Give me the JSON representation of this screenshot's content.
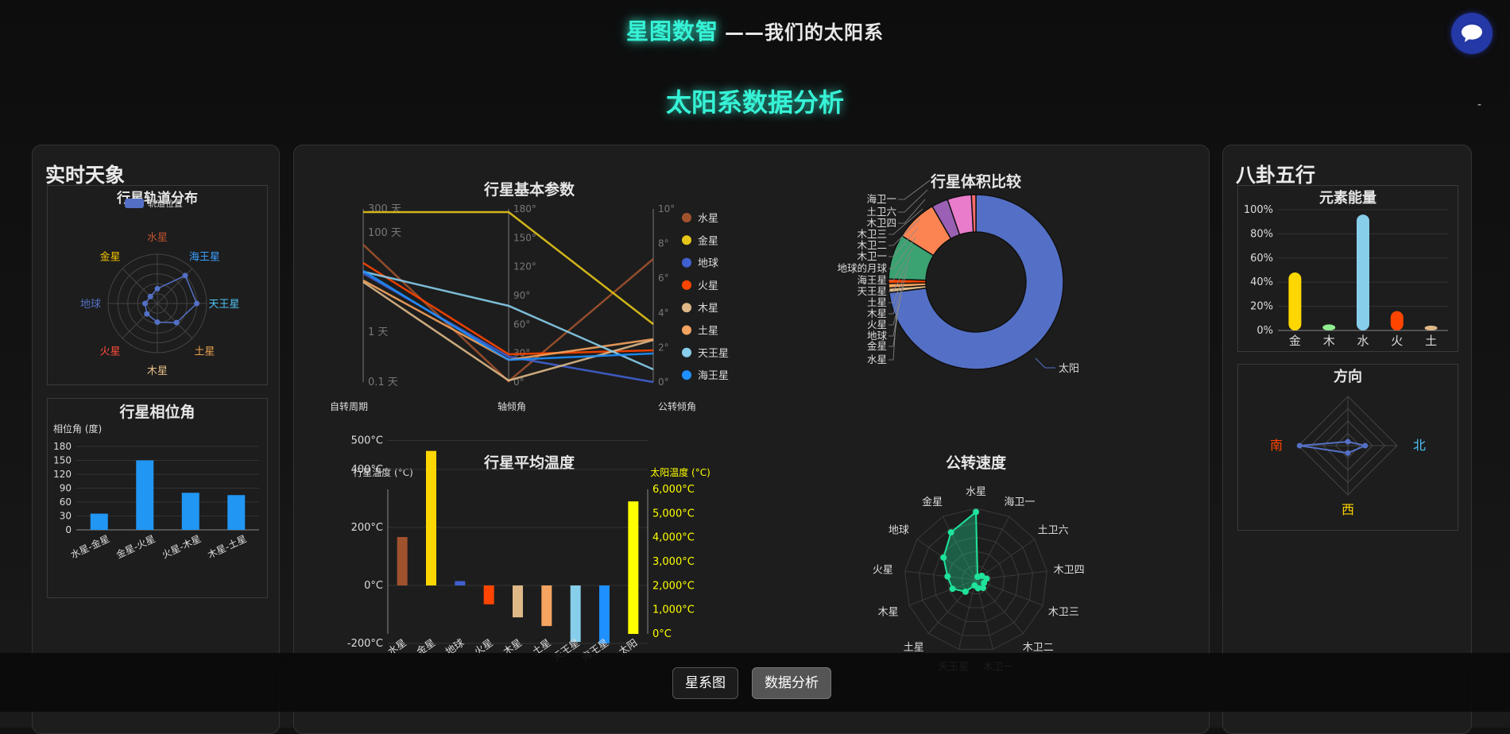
{
  "header": {
    "brand": "星图数智",
    "subtitle": "——我们的太阳系"
  },
  "page": {
    "title": "太阳系数据分析",
    "dash": "-"
  },
  "chat_icon": "chat-bubble-icon",
  "left_panel": {
    "title": "实时天象",
    "orbit": {
      "title": "行星轨道分布",
      "legend": "轨道位置",
      "labels": [
        "水星",
        "海王星",
        "天王星",
        "土星",
        "木星",
        "火星",
        "地球",
        "金星"
      ],
      "colors": [
        "#c0532f",
        "#3aa0ff",
        "#4fc3f7",
        "#e8a04c",
        "#e8c08a",
        "#ff4d3a",
        "#5470c6",
        "#f5c400"
      ],
      "values": [
        0.3,
        0.8,
        0.8,
        0.55,
        0.38,
        0.3,
        0.25,
        0.2
      ]
    },
    "aspect": {
      "title": "行星相位角",
      "ylabel": "相位角 (度)",
      "yticks": [
        "180",
        "150",
        "120",
        "90",
        "60",
        "30",
        "0"
      ],
      "categories": [
        "水星-金星",
        "金星-火星",
        "火星-木星",
        "木星-土星"
      ],
      "values": [
        35,
        150,
        80,
        75
      ]
    }
  },
  "center_panel": {
    "params_chart": {
      "title": "行星基本参数",
      "axes": [
        "自转周期",
        "轴倾角",
        "公转倾角"
      ],
      "ticks1": [
        "300 天",
        "100 天",
        "1 天",
        "0.1 天"
      ],
      "ticks2": [
        "180°",
        "150°",
        "120°",
        "90°",
        "60°",
        "30°",
        "0°"
      ],
      "ticks3": [
        "10°",
        "8°",
        "6°",
        "4°",
        "2°",
        "0°"
      ],
      "legend": [
        "水星",
        "金星",
        "地球",
        "火星",
        "木星",
        "土星",
        "天王星",
        "海王星"
      ],
      "colors": [
        "#a0522d",
        "#e6c619",
        "#4060d0",
        "#ff4500",
        "#deb887",
        "#f4a460",
        "#87ceeb",
        "#1e90ff"
      ]
    },
    "volume_chart": {
      "title": "行星体积比较",
      "labels": [
        "太阳",
        "水星",
        "金星",
        "地球",
        "火星",
        "木星",
        "土星",
        "天王星",
        "海王星",
        "地球的月球",
        "木卫一",
        "木卫二",
        "木卫三",
        "木卫四",
        "土卫六",
        "海卫一"
      ]
    },
    "temp_chart": {
      "title": "行星平均温度",
      "ylabel_left": "行星温度 (°C)",
      "ylabel_right": "太阳温度 (°C)",
      "yticks_left": [
        "500°C",
        "400°C",
        "200°C",
        "0°C",
        "-200°C"
      ],
      "yticks_right": [
        "6,000°C",
        "5,000°C",
        "4,000°C",
        "3,000°C",
        "2,000°C",
        "1,000°C",
        "0°C"
      ],
      "categories": [
        "水星",
        "金星",
        "地球",
        "火星",
        "木星",
        "土星",
        "天王星",
        "海王星",
        "太阳"
      ],
      "values": [
        167,
        464,
        15,
        -65,
        -110,
        -140,
        -195,
        -200,
        5500
      ]
    },
    "speed_chart": {
      "title": "公转速度",
      "labels": [
        "水星",
        "海卫一",
        "土卫六",
        "木卫四",
        "木卫三",
        "木卫二",
        "木卫一",
        "天王星",
        "土星",
        "木星",
        "火星",
        "地球",
        "金星"
      ]
    }
  },
  "right_panel": {
    "title": "八卦五行",
    "energy": {
      "title": "元素能量",
      "yticks": [
        "100%",
        "80%",
        "60%",
        "40%",
        "20%",
        "0%"
      ],
      "categories": [
        "金",
        "木",
        "水",
        "火",
        "土"
      ],
      "values": [
        48,
        5,
        96,
        16,
        4
      ],
      "colors": [
        "#ffd700",
        "#90ee90",
        "#87ceeb",
        "#ff4500",
        "#deb887"
      ]
    },
    "direction": {
      "title": "方向",
      "labels": [
        "南",
        "北",
        "西"
      ]
    }
  },
  "bottom_nav": {
    "btn1": "星系图",
    "btn2": "数据分析"
  }
}
